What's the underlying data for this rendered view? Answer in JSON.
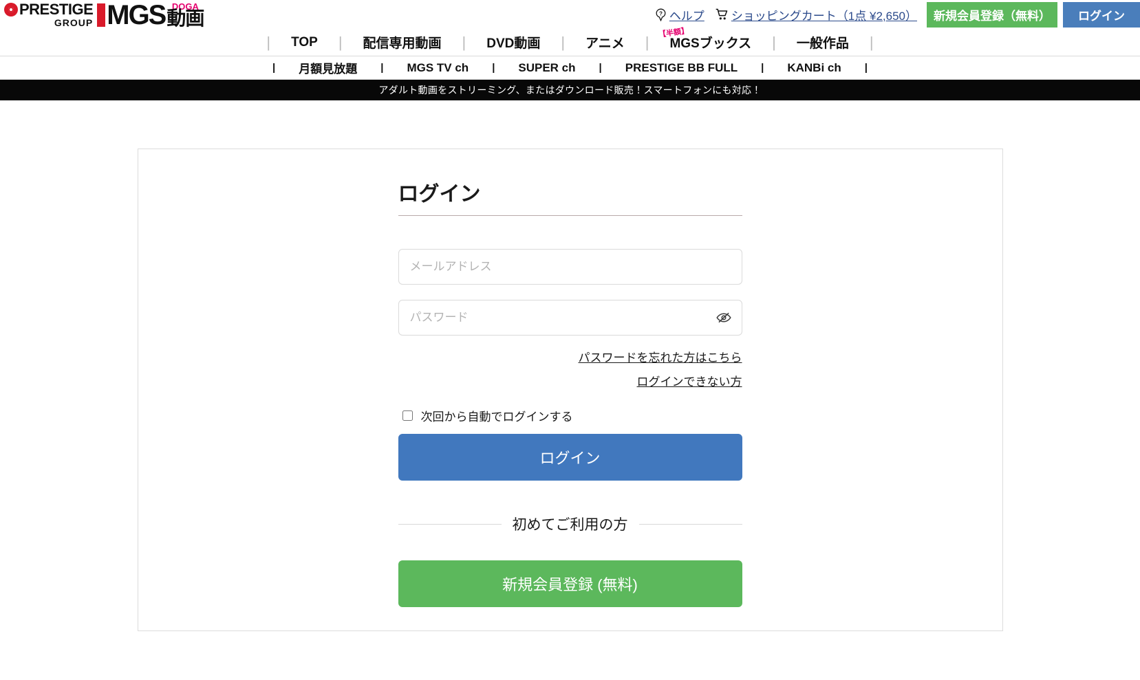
{
  "header": {
    "logo": {
      "prestige_name": "PRESTIGE",
      "prestige_group": "GROUP",
      "mgs_text": "MGS",
      "doga_en": "DOGA",
      "doga_jp": "動画"
    },
    "help_link": "ヘルプ",
    "help_icon": "question-mark-circle-icon",
    "cart_link": "ショッピングカート（1点 ¥2,650）",
    "cart_icon": "shopping-cart-icon",
    "register_button": "新規会員登録（無料）",
    "login_button": "ログイン",
    "register_color": "#5cb85c",
    "login_color": "#4a7ebb"
  },
  "nav_main": {
    "items": [
      {
        "label": "TOP",
        "badge": ""
      },
      {
        "label": "配信専用動画",
        "badge": ""
      },
      {
        "label": "DVD動画",
        "badge": ""
      },
      {
        "label": "アニメ",
        "badge": ""
      },
      {
        "label": "MGSブックス",
        "badge": "【半額】"
      },
      {
        "label": "一般作品",
        "badge": ""
      }
    ],
    "separator": "|"
  },
  "nav_sub": {
    "items": [
      {
        "label": "月額見放題"
      },
      {
        "label": "MGS TV ch"
      },
      {
        "label": "SUPER ch"
      },
      {
        "label": "PRESTIGE BB FULL"
      },
      {
        "label": "KANBi ch"
      }
    ],
    "separator": "|"
  },
  "promo": {
    "text": "アダルト動画をストリーミング、またはダウンロード販売！スマートフォンにも対応！",
    "background": "#080808"
  },
  "login_form": {
    "title": "ログイン",
    "email": {
      "placeholder": "メールアドレス",
      "value": ""
    },
    "password": {
      "placeholder": "パスワード",
      "value": "",
      "toggle_icon": "eye-slash-icon"
    },
    "forgot_password_link": "パスワードを忘れた方はこちら",
    "cannot_login_link": "ログインできない方",
    "remember_label": "次回から自動でログインする",
    "remember_checked": false,
    "submit_button": "ログイン",
    "submit_color": "#4178be",
    "divider_text": "初めてご利用の方",
    "register_button": "新規会員登録 (無料)",
    "register_color": "#5cb85c"
  }
}
